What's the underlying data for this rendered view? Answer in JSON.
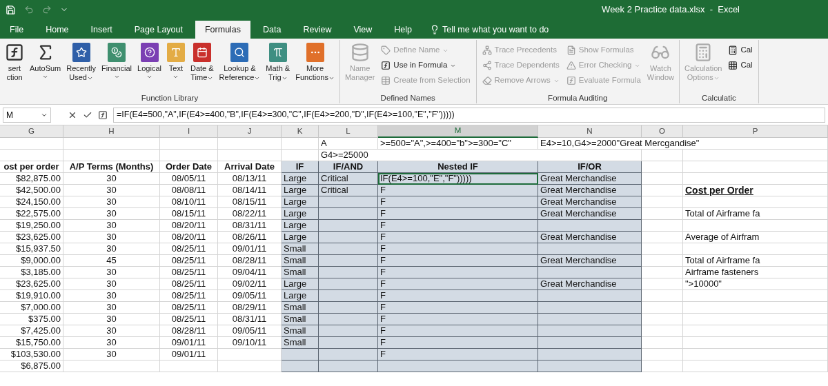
{
  "window": {
    "title": "Week 2 Practice data.xlsx  -  Excel"
  },
  "tabs": [
    {
      "label": "File",
      "selected": false
    },
    {
      "label": "Home",
      "selected": false
    },
    {
      "label": "Insert",
      "selected": false
    },
    {
      "label": "Page Layout",
      "selected": false
    },
    {
      "label": "Formulas",
      "selected": true
    },
    {
      "label": "Data",
      "selected": false
    },
    {
      "label": "Review",
      "selected": false
    },
    {
      "label": "View",
      "selected": false
    },
    {
      "label": "Help",
      "selected": false
    }
  ],
  "tell_me": "Tell me what you want to do",
  "ribbon": {
    "groups": [
      {
        "name": "Function Library",
        "items": [
          {
            "kind": "large",
            "label": "sert\nction",
            "disabled": false,
            "dropdown": false
          },
          {
            "kind": "large",
            "label": "AutoSum",
            "disabled": false,
            "dropdown": true
          },
          {
            "kind": "large",
            "label": "Recently\nUsed",
            "disabled": false,
            "dropdown": true,
            "color": "#2f5fa8"
          },
          {
            "kind": "large",
            "label": "Financial",
            "disabled": false,
            "dropdown": true,
            "color": "#3f8f6f"
          },
          {
            "kind": "large",
            "label": "Logical",
            "disabled": false,
            "dropdown": true,
            "color": "#7b3fb3"
          },
          {
            "kind": "large",
            "label": "Text",
            "disabled": false,
            "dropdown": true,
            "color": "#e3ac45"
          },
          {
            "kind": "large",
            "label": "Date &\nTime",
            "disabled": false,
            "dropdown": true,
            "color": "#c9302c"
          },
          {
            "kind": "large",
            "label": "Lookup &\nReference",
            "disabled": false,
            "dropdown": true,
            "color": "#2c6cb6"
          },
          {
            "kind": "large",
            "label": "Math &\nTrig",
            "disabled": false,
            "dropdown": true,
            "color": "#3f8f82"
          },
          {
            "kind": "large",
            "label": "More\nFunctions",
            "disabled": false,
            "dropdown": true,
            "color": "#e0702a"
          }
        ]
      },
      {
        "name": "Defined Names",
        "items": [
          {
            "kind": "large",
            "label": "Name\nManager",
            "disabled": true,
            "dropdown": false
          },
          {
            "kind": "small",
            "label": "Define Name",
            "disabled": true,
            "dropdown": true
          },
          {
            "kind": "small",
            "label": "Use in Formula",
            "disabled": false,
            "dropdown": true
          },
          {
            "kind": "small",
            "label": "Create from Selection",
            "disabled": true,
            "dropdown": false
          }
        ]
      },
      {
        "name": "Formula Auditing",
        "items": [
          {
            "kind": "small",
            "label": "Trace Precedents",
            "disabled": true,
            "dropdown": false
          },
          {
            "kind": "small",
            "label": "Trace Dependents",
            "disabled": true,
            "dropdown": false
          },
          {
            "kind": "small",
            "label": "Remove Arrows",
            "disabled": true,
            "dropdown": true
          },
          {
            "kind": "small",
            "label": "Show Formulas",
            "disabled": true,
            "dropdown": false
          },
          {
            "kind": "small",
            "label": "Error Checking",
            "disabled": true,
            "dropdown": true
          },
          {
            "kind": "small",
            "label": "Evaluate Formula",
            "disabled": true,
            "dropdown": false
          },
          {
            "kind": "large",
            "label": "Watch\nWindow",
            "disabled": true,
            "dropdown": false
          }
        ]
      },
      {
        "name": "Calculatic",
        "items": [
          {
            "kind": "large",
            "label": "Calculation\nOptions",
            "disabled": true,
            "dropdown": true
          },
          {
            "kind": "small",
            "label": "Cal",
            "disabled": false,
            "dropdown": false
          },
          {
            "kind": "small",
            "label": "Cal",
            "disabled": false,
            "dropdown": false
          }
        ]
      }
    ]
  },
  "formula_bar": {
    "name_box": "M",
    "formula": "=IF(E4=500,\"A\",IF(E4>=400,\"B\",IF(E4>=300,\"C\",IF(E4>=200,\"D\",IF(E4>=100,\"E\",\"F\")))))"
  },
  "columns": [
    {
      "name": "G",
      "shaded": false,
      "selected": false
    },
    {
      "name": "H",
      "shaded": false,
      "selected": false
    },
    {
      "name": "I",
      "shaded": false,
      "selected": false
    },
    {
      "name": "J",
      "shaded": false,
      "selected": false
    },
    {
      "name": "K",
      "shaded": true,
      "selected": false
    },
    {
      "name": "L",
      "shaded": true,
      "selected": false
    },
    {
      "name": "M",
      "shaded": true,
      "selected": true
    },
    {
      "name": "N",
      "shaded": true,
      "selected": false
    },
    {
      "name": "O",
      "shaded": false,
      "selected": false
    },
    {
      "name": "P",
      "shaded": false,
      "selected": false
    }
  ],
  "rows": [
    {
      "kind": "note",
      "selected": false,
      "cells": [
        null,
        null,
        null,
        null,
        null,
        "A",
        ">=500=\"A\",>=400=\"b\">=300=\"C\"",
        "E4>=10,G4>=2000\"Great Mercgandise\"",
        null,
        null
      ]
    },
    {
      "kind": "note",
      "selected": false,
      "cells": [
        null,
        null,
        null,
        null,
        null,
        "G4>=25000",
        null,
        null,
        null,
        null
      ]
    },
    {
      "kind": "header",
      "selected": false,
      "cells": [
        "ost per order",
        "A/P Terms (Months)",
        "Order Date",
        "Arrival Date",
        "IF",
        "IF/AND",
        "Nested IF",
        "IF/OR",
        null,
        null
      ]
    },
    {
      "kind": "data",
      "selected": true,
      "cells": [
        "$82,875.00",
        "30",
        "08/05/11",
        "08/13/11",
        "Large",
        "Critical",
        "IF(E4>=100,\"E\",\"F\")))))",
        "Great Merchandise",
        null,
        null
      ]
    },
    {
      "kind": "data",
      "selected": false,
      "cells": [
        "$42,500.00",
        "30",
        "08/08/11",
        "08/14/11",
        "Large",
        "Critical",
        "F",
        "Great Merchandise",
        null,
        {
          "text": "Cost per Order",
          "kind": "heading"
        }
      ]
    },
    {
      "kind": "data",
      "selected": false,
      "cells": [
        "$24,150.00",
        "30",
        "08/10/11",
        "08/15/11",
        "Large",
        null,
        "F",
        "Great Merchandise",
        null,
        null
      ]
    },
    {
      "kind": "data",
      "selected": false,
      "cells": [
        "$22,575.00",
        "30",
        "08/15/11",
        "08/22/11",
        "Large",
        null,
        "F",
        "Great Merchandise",
        null,
        "Total of Airframe fa"
      ]
    },
    {
      "kind": "data",
      "selected": false,
      "cells": [
        "$19,250.00",
        "30",
        "08/20/11",
        "08/31/11",
        "Large",
        null,
        "F",
        null,
        null,
        null
      ]
    },
    {
      "kind": "data",
      "selected": false,
      "cells": [
        "$23,625.00",
        "30",
        "08/20/11",
        "08/26/11",
        "Large",
        null,
        "F",
        "Great Merchandise",
        null,
        "Average of Airfram"
      ]
    },
    {
      "kind": "data",
      "selected": false,
      "cells": [
        "$15,937.50",
        "30",
        "08/25/11",
        "09/01/11",
        "Small",
        null,
        "F",
        null,
        null,
        null
      ]
    },
    {
      "kind": "data",
      "selected": false,
      "cells": [
        "$9,000.00",
        "45",
        "08/25/11",
        "08/28/11",
        "Small",
        null,
        "F",
        "Great Merchandise",
        null,
        "Total of Airframe fa"
      ]
    },
    {
      "kind": "data",
      "selected": false,
      "cells": [
        "$3,185.00",
        "30",
        "08/25/11",
        "09/04/11",
        "Small",
        null,
        "F",
        null,
        null,
        "Airframe fasteners"
      ]
    },
    {
      "kind": "data",
      "selected": false,
      "cells": [
        "$23,625.00",
        "30",
        "08/25/11",
        "09/02/11",
        "Large",
        null,
        "F",
        "Great Merchandise",
        null,
        "\">10000\""
      ]
    },
    {
      "kind": "data",
      "selected": false,
      "cells": [
        "$19,910.00",
        "30",
        "08/25/11",
        "09/05/11",
        "Large",
        null,
        "F",
        null,
        null,
        null
      ]
    },
    {
      "kind": "data",
      "selected": false,
      "cells": [
        "$7,000.00",
        "30",
        "08/25/11",
        "08/29/11",
        "Small",
        null,
        "F",
        null,
        null,
        null
      ]
    },
    {
      "kind": "data",
      "selected": false,
      "cells": [
        "$375.00",
        "30",
        "08/25/11",
        "08/31/11",
        "Small",
        null,
        "F",
        null,
        null,
        null
      ]
    },
    {
      "kind": "data",
      "selected": false,
      "cells": [
        "$7,425.00",
        "30",
        "08/28/11",
        "09/05/11",
        "Small",
        null,
        "F",
        null,
        null,
        null
      ]
    },
    {
      "kind": "data",
      "selected": false,
      "cells": [
        "$15,750.00",
        "30",
        "09/01/11",
        "09/10/11",
        "Small",
        null,
        "F",
        null,
        null,
        null
      ]
    },
    {
      "kind": "data",
      "selected": false,
      "cells": [
        "$103,530.00",
        "30",
        "09/01/11",
        null,
        null,
        null,
        "F",
        null,
        null,
        null
      ]
    },
    {
      "kind": "data",
      "selected": false,
      "cells": [
        "$6,875.00",
        null,
        null,
        null,
        null,
        null,
        null,
        null,
        null,
        null
      ]
    }
  ]
}
